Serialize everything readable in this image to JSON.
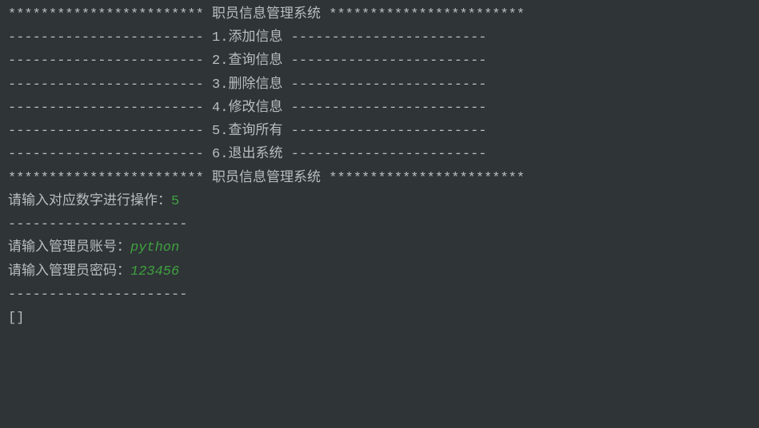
{
  "header": {
    "star_prefix": "************************ ",
    "title": "职员信息管理系统 ",
    "star_suffix": "************************"
  },
  "menu": {
    "dash_prefix": "------------------------ ",
    "dash_suffix": " ------------------------",
    "items": [
      "1.添加信息",
      "2.查询信息",
      "3.删除信息",
      "4.修改信息",
      "5.查询所有",
      "6.退出系统"
    ]
  },
  "footer": {
    "star_prefix": "************************ ",
    "title": "职员信息管理系统 ",
    "star_suffix": "************************"
  },
  "prompts": {
    "operation_label": "请输入对应数字进行操作：",
    "operation_value": "5",
    "separator1": "----------------------",
    "admin_user_label": "请输入管理员账号：",
    "admin_user_value": "python",
    "admin_pass_label": "请输入管理员密码：",
    "admin_pass_value": "123456",
    "separator2": "----------------------"
  },
  "result": "[]"
}
